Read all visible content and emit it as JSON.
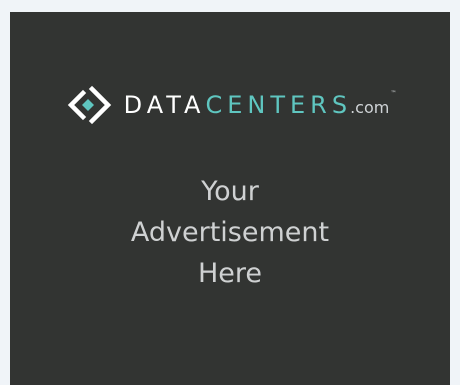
{
  "logo": {
    "data_text": "DATA",
    "centers_text": "CENTERS",
    "com_text": ".com",
    "tm_text": "™",
    "icon": "datacenters-diamond-logo-icon",
    "colors": {
      "data": "#ffffff",
      "centers": "#5fc6c0",
      "com": "#cfd3d6"
    }
  },
  "ad": {
    "lines": [
      "Your",
      "Advertisement",
      "Here"
    ]
  },
  "colors": {
    "card_background": "#323432",
    "page_background": "#f0f4f8",
    "ad_text": "#cfd1d2"
  }
}
